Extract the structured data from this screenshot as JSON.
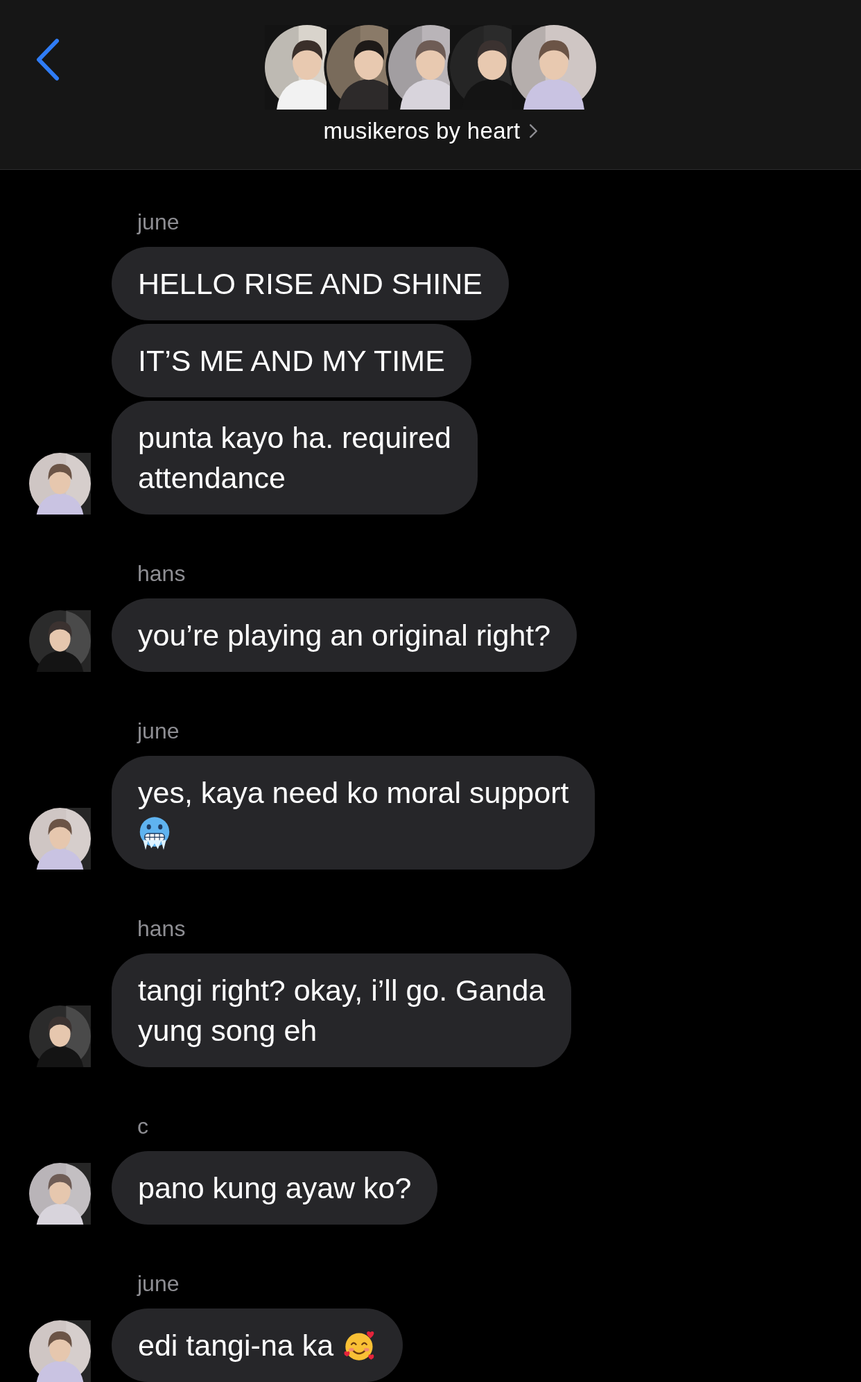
{
  "header": {
    "title": "musikeros by heart",
    "avatars": [
      {
        "kind": "picture"
      },
      {
        "kind": "picture"
      },
      {
        "kind": "picture"
      },
      {
        "kind": "picture"
      },
      {
        "kind": "picture"
      }
    ]
  },
  "groups": [
    {
      "sender": "june",
      "avatar": {
        "kind": "picture"
      },
      "messages": [
        {
          "lines": [
            [
              {
                "kind": "text",
                "text": "HELLO RISE AND SHINE"
              }
            ]
          ]
        },
        {
          "lines": [
            [
              {
                "kind": "text",
                "text": "IT’S ME AND MY TIME"
              }
            ]
          ]
        },
        {
          "lines": [
            [
              {
                "kind": "text",
                "text": "punta kayo ha. required"
              }
            ],
            [
              {
                "kind": "text",
                "text": "attendance"
              }
            ]
          ]
        }
      ]
    },
    {
      "sender": "hans",
      "avatar": {
        "kind": "picture"
      },
      "messages": [
        {
          "lines": [
            [
              {
                "kind": "text",
                "text": "you’re playing an original right?"
              }
            ]
          ]
        }
      ]
    },
    {
      "sender": "june",
      "avatar": {
        "kind": "picture"
      },
      "messages": [
        {
          "lines": [
            [
              {
                "kind": "text",
                "text": "yes, kaya need ko moral support"
              }
            ],
            [
              {
                "kind": "cold_face"
              }
            ]
          ]
        }
      ]
    },
    {
      "sender": "hans",
      "avatar": {
        "kind": "picture"
      },
      "messages": [
        {
          "lines": [
            [
              {
                "kind": "text",
                "text": "tangi right? okay, i’ll go. Ganda"
              }
            ],
            [
              {
                "kind": "text",
                "text": "yung song eh"
              }
            ]
          ]
        }
      ]
    },
    {
      "sender": "c",
      "avatar": {
        "kind": "picture"
      },
      "messages": [
        {
          "lines": [
            [
              {
                "kind": "text",
                "text": "pano kung ayaw ko?"
              }
            ]
          ]
        }
      ]
    },
    {
      "sender": "june",
      "avatar": {
        "kind": "picture"
      },
      "messages": [
        {
          "lines": [
            [
              {
                "kind": "text",
                "text": "edi tangi-na ka"
              },
              {
                "kind": "hearts_face"
              }
            ]
          ]
        }
      ]
    }
  ]
}
